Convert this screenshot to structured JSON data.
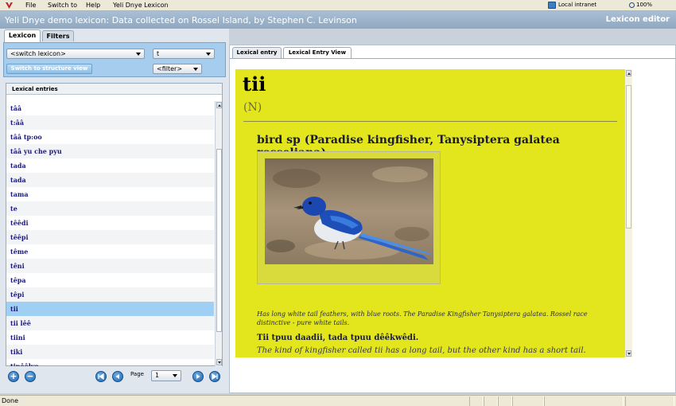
{
  "menubar": {
    "items": [
      "File",
      "Switch to",
      "Help",
      "Yeli Dnye Lexicon"
    ]
  },
  "window": {
    "title": "Yeli Dnye demo lexicon: Data collected on Rossel Island, by Stephen C. Levinson",
    "brand": "Lexicon editor"
  },
  "left": {
    "tabs": [
      "Lexicon",
      "Filters"
    ],
    "lexicon_select": "<switch lexicon>",
    "letter_select": "t",
    "filter_select": "<filter>",
    "switch_view_label": "Switch to structure view",
    "entries_header": "Lexical entries",
    "entries": [
      "tââ",
      "t:ââ",
      "tââ tp:oo",
      "tââ yu che pyu",
      "tada",
      "tada",
      "tama",
      "te",
      "têêdi",
      "têêpi",
      "têmе",
      "têni",
      "têpa",
      "têpi",
      "tii",
      "tii lêê",
      "tiini",
      "tiki",
      "tinêêlyo"
    ],
    "selected_index": 14,
    "page_label": "Page",
    "page_value": "1"
  },
  "right": {
    "tabs": [
      "Lexical entry",
      "Lexical Entry View"
    ],
    "entry": {
      "headword": "tii",
      "pos": "(N)",
      "gloss": "bird sp (Paradise kingfisher, Tanysiptera galatea rosseliana)",
      "description": "Has long white tail feathers, with blue roots. The Paradise Kingfisher Tanysiptera galatea. Rossel race distinctive - pure white tails.",
      "example": "Tii tpuu daadii, tada tpuu dêêkwêdi.",
      "translation": "The kind of kingfisher called tii has a long tail, but the other kind has a short tail."
    },
    "background_color": "#e3e61c"
  },
  "status": {
    "text": "Done",
    "zone": "Local intranet",
    "zoom": "100%"
  }
}
